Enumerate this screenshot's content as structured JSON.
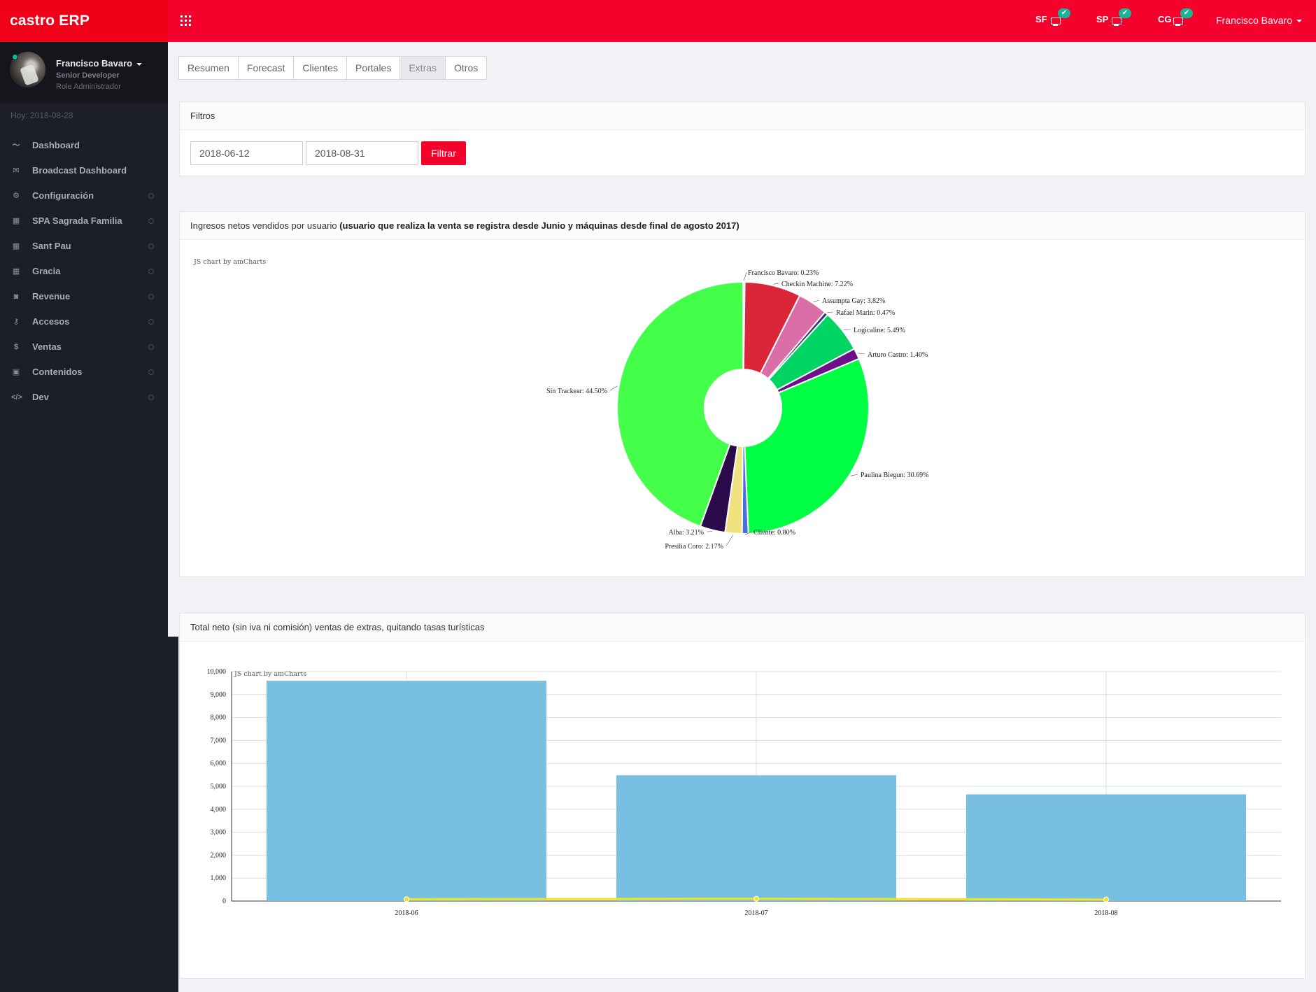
{
  "app": {
    "brand": "castro ERP",
    "user_menu": "Francisco Bavaro",
    "status": [
      {
        "label": "SF",
        "check": "✔"
      },
      {
        "label": "SP",
        "check": "✔"
      },
      {
        "label": "CG",
        "check": "✔"
      }
    ]
  },
  "sidebar": {
    "profile": {
      "name": "Francisco Bavaro",
      "role": "Senior Developer",
      "admin": "Role Administrador"
    },
    "today": "Hoy: 2018-08-28",
    "items": [
      {
        "label": "Dashboard",
        "icon": "chart-line-icon",
        "glyph": "〜",
        "has_dot": false
      },
      {
        "label": "Broadcast Dashboard",
        "icon": "envelope-icon",
        "glyph": "✉",
        "has_dot": false
      },
      {
        "label": "Configuración",
        "icon": "gear-icon",
        "glyph": "⚙",
        "has_dot": true
      },
      {
        "label": "SPA Sagrada Familia",
        "icon": "building-icon",
        "glyph": "▦",
        "has_dot": true
      },
      {
        "label": "Sant Pau",
        "icon": "building-icon",
        "glyph": "▦",
        "has_dot": true
      },
      {
        "label": "Gracia",
        "icon": "building-icon",
        "glyph": "▦",
        "has_dot": true
      },
      {
        "label": "Revenue",
        "icon": "money-icon",
        "glyph": "◙",
        "has_dot": true
      },
      {
        "label": "Accesos",
        "icon": "key-icon",
        "glyph": "⚷",
        "has_dot": true
      },
      {
        "label": "Ventas",
        "icon": "dollar-icon",
        "glyph": "$",
        "has_dot": true
      },
      {
        "label": "Contenidos",
        "icon": "image-icon",
        "glyph": "▣",
        "has_dot": true
      },
      {
        "label": "Dev",
        "icon": "code-icon",
        "glyph": "</>",
        "has_dot": true
      }
    ]
  },
  "tabs": [
    {
      "label": "Resumen",
      "active": false
    },
    {
      "label": "Forecast",
      "active": false
    },
    {
      "label": "Clientes",
      "active": false
    },
    {
      "label": "Portales",
      "active": false
    },
    {
      "label": "Extras",
      "active": true
    },
    {
      "label": "Otros",
      "active": false
    }
  ],
  "filters": {
    "title": "Filtros",
    "date_from": "2018-06-12",
    "date_to": "2018-08-31",
    "button": "Filtrar"
  },
  "pie_panel": {
    "title_prefix": "Ingresos netos vendidos por usuario ",
    "title_bold": "(usuario que realiza la venta se registra desde Junio y máquinas desde final de agosto 2017)",
    "credit": "JS chart by amCharts"
  },
  "bar_panel": {
    "title": "Total neto (sin iva ni comisión) ventas de extras, quitando tasas turísticas",
    "credit": "JS chart by amCharts"
  },
  "chart_data": [
    {
      "type": "pie",
      "slices": [
        {
          "label": "Francisco Bavaro",
          "value": 0.23,
          "color": "#d6d6d6"
        },
        {
          "label": "Checkin Machine",
          "value": 7.22,
          "color": "#db2637"
        },
        {
          "label": "Assumpta Gay",
          "value": 3.82,
          "color": "#d96fa6"
        },
        {
          "label": "Rafael Marin",
          "value": 0.47,
          "color": "#303a6e"
        },
        {
          "label": "Logicaline",
          "value": 5.49,
          "color": "#00d463"
        },
        {
          "label": "Arturo Castro",
          "value": 1.4,
          "color": "#6e0f8a"
        },
        {
          "label": "Paulina Biegun",
          "value": 30.69,
          "color": "#00ff44"
        },
        {
          "label": "Cliente",
          "value": 0.8,
          "color": "#4a6fd6"
        },
        {
          "label": "Presilia Coro",
          "value": 2.17,
          "color": "#f0e280"
        },
        {
          "label": "Alba",
          "value": 3.21,
          "color": "#2a0a4a"
        },
        {
          "label": "Sin Trackear",
          "value": 44.5,
          "color": "#44ff4a"
        }
      ]
    },
    {
      "type": "bar",
      "categories": [
        "2018-06",
        "2018-07",
        "2018-08"
      ],
      "series": [
        {
          "values": [
            9600,
            5480,
            4650
          ],
          "color": "#78c0e2"
        },
        {
          "values": [
            80,
            100,
            70
          ],
          "color": "#f2e51d"
        }
      ],
      "ylim": [
        0,
        10000
      ],
      "yticks": [
        "0",
        "1,000",
        "2,000",
        "3,000",
        "4,000",
        "5,000",
        "6,000",
        "7,000",
        "8,000",
        "9,000",
        "10,000"
      ],
      "grid": true
    }
  ]
}
